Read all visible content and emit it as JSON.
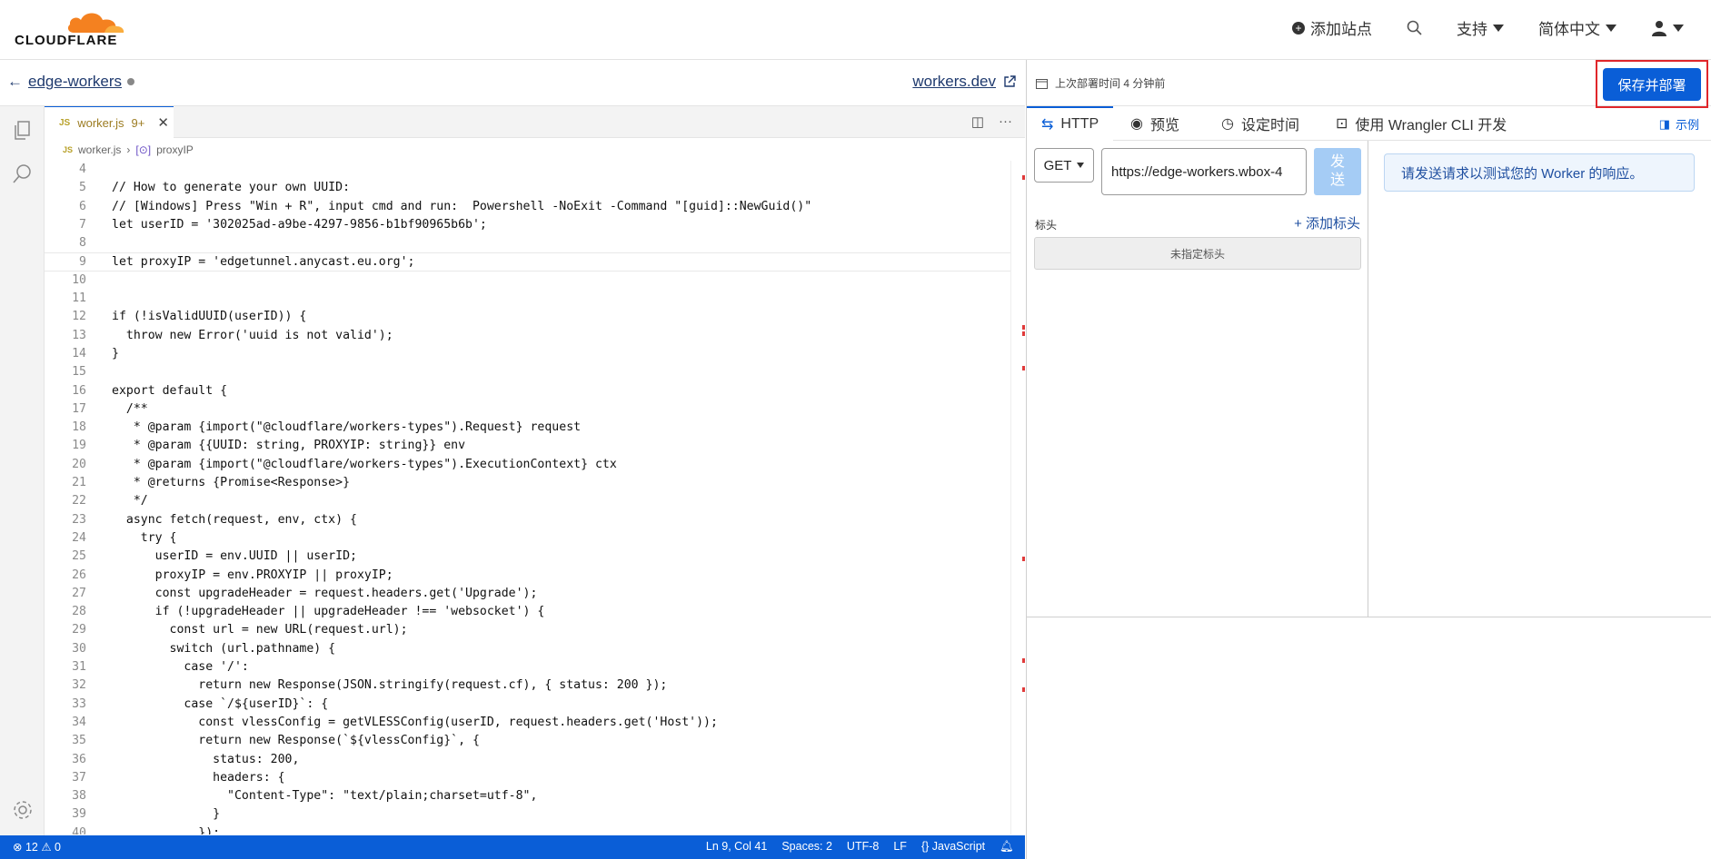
{
  "topbar": {
    "logo_text": "CLOUDFLARE",
    "add_site": "添加站点",
    "support": "支持",
    "language": "简体中文"
  },
  "editor_header": {
    "worker_name": "edge-workers",
    "workers_dev": "workers.dev"
  },
  "deploy": {
    "last_deploy": "上次部署时间 4 分钟前",
    "save_button": "保存并部署"
  },
  "editor": {
    "tab_name": "worker.js",
    "tab_badge": "9+",
    "breadcrumb_file": "worker.js",
    "breadcrumb_symbol": "proxyIP",
    "lines": [
      {
        "n": "4",
        "t": ""
      },
      {
        "n": "5",
        "t": "// How to generate your own UUID:"
      },
      {
        "n": "6",
        "t": "// [Windows] Press \"Win + R\", input cmd and run:  Powershell -NoExit -Command \"[guid]::NewGuid()\""
      },
      {
        "n": "7",
        "t": "let userID = '302025ad-a9be-4297-9856-b1bf90965b6b';"
      },
      {
        "n": "8",
        "t": ""
      },
      {
        "n": "9",
        "t": "let proxyIP = 'edgetunnel.anycast.eu.org';"
      },
      {
        "n": "10",
        "t": ""
      },
      {
        "n": "11",
        "t": ""
      },
      {
        "n": "12",
        "t": "if (!isValidUUID(userID)) {"
      },
      {
        "n": "13",
        "t": "  throw new Error('uuid is not valid');"
      },
      {
        "n": "14",
        "t": "}"
      },
      {
        "n": "15",
        "t": ""
      },
      {
        "n": "16",
        "t": "export default {"
      },
      {
        "n": "17",
        "t": "  /**"
      },
      {
        "n": "18",
        "t": "   * @param {import(\"@cloudflare/workers-types\").Request} request"
      },
      {
        "n": "19",
        "t": "   * @param {{UUID: string, PROXYIP: string}} env"
      },
      {
        "n": "20",
        "t": "   * @param {import(\"@cloudflare/workers-types\").ExecutionContext} ctx"
      },
      {
        "n": "21",
        "t": "   * @returns {Promise<Response>}"
      },
      {
        "n": "22",
        "t": "   */"
      },
      {
        "n": "23",
        "t": "  async fetch(request, env, ctx) {"
      },
      {
        "n": "24",
        "t": "    try {"
      },
      {
        "n": "25",
        "t": "      userID = env.UUID || userID;"
      },
      {
        "n": "26",
        "t": "      proxyIP = env.PROXYIP || proxyIP;"
      },
      {
        "n": "27",
        "t": "      const upgradeHeader = request.headers.get('Upgrade');"
      },
      {
        "n": "28",
        "t": "      if (!upgradeHeader || upgradeHeader !== 'websocket') {"
      },
      {
        "n": "29",
        "t": "        const url = new URL(request.url);"
      },
      {
        "n": "30",
        "t": "        switch (url.pathname) {"
      },
      {
        "n": "31",
        "t": "          case '/':"
      },
      {
        "n": "32",
        "t": "            return new Response(JSON.stringify(request.cf), { status: 200 });"
      },
      {
        "n": "33",
        "t": "          case `/${userID}`: {"
      },
      {
        "n": "34",
        "t": "            const vlessConfig = getVLESSConfig(userID, request.headers.get('Host'));"
      },
      {
        "n": "35",
        "t": "            return new Response(`${vlessConfig}`, {"
      },
      {
        "n": "36",
        "t": "              status: 200,"
      },
      {
        "n": "37",
        "t": "              headers: {"
      },
      {
        "n": "38",
        "t": "                \"Content-Type\": \"text/plain;charset=utf-8\","
      },
      {
        "n": "39",
        "t": "              }"
      },
      {
        "n": "40",
        "t": "            });"
      }
    ]
  },
  "statusbar": {
    "errors": "⊗ 12 ⚠ 0",
    "position": "Ln 9, Col 41",
    "spaces": "Spaces: 2",
    "encoding": "UTF-8",
    "eol": "LF",
    "language": "{} JavaScript"
  },
  "right_panel": {
    "tabs": [
      "HTTP",
      "预览",
      "设定时间",
      "使用 Wrangler CLI 开发"
    ],
    "example": "示例",
    "method": "GET",
    "url": "https://edge-workers.wbox-4",
    "send_line1": "发",
    "send_line2": "送",
    "headers_label": "标头",
    "add_header": "+ 添加标头",
    "no_headers": "未指定标头",
    "response_hint": "请发送请求以测试您的 Worker 的响应。"
  }
}
